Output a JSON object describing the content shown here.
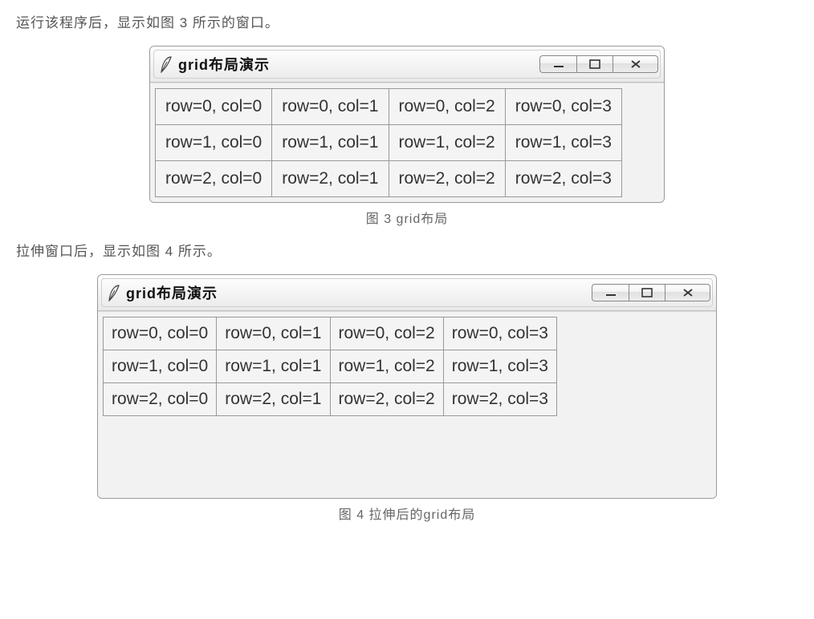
{
  "text": {
    "intro_a": "运行该程序后，显示如图 3 所示的窗口。",
    "caption_a": "图 3 grid布局",
    "intro_b": "拉伸窗口后，显示如图 4 所示。",
    "caption_b": "图 4 拉伸后的grid布局"
  },
  "window": {
    "title": "grid布局演示",
    "icon_name": "feather-icon"
  },
  "grid": {
    "rows": 3,
    "cols": 4,
    "cells": [
      [
        "row=0, col=0",
        "row=0, col=1",
        "row=0, col=2",
        "row=0, col=3"
      ],
      [
        "row=1, col=0",
        "row=1, col=1",
        "row=1, col=2",
        "row=1, col=3"
      ],
      [
        "row=2, col=0",
        "row=2, col=1",
        "row=2, col=2",
        "row=2, col=3"
      ]
    ]
  },
  "buttons": {
    "minimize": "minimize",
    "maximize": "maximize",
    "close": "close"
  }
}
